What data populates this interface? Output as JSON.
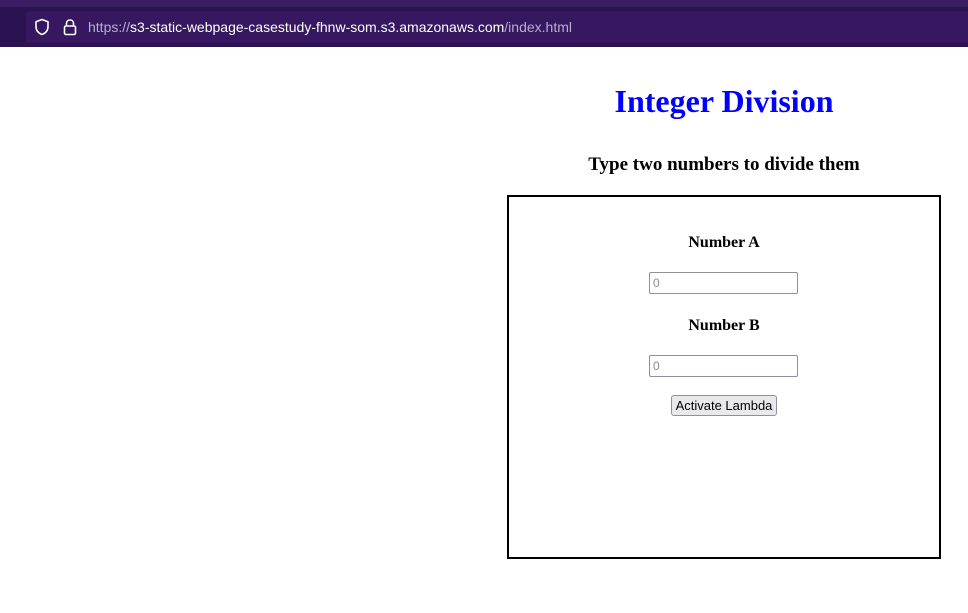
{
  "browser": {
    "url_scheme": "https://",
    "url_host": "s3-static-webpage-casestudy-fhnw-som.s3.amazonaws.com",
    "url_path": "/index.html",
    "icons": [
      "shield-icon",
      "lock-icon"
    ]
  },
  "page": {
    "title": "Integer Division",
    "subtitle": "Type two numbers to divide them",
    "title_color": "#0000ff"
  },
  "form": {
    "label_a": "Number A",
    "input_a_placeholder": "0",
    "label_b": "Number B",
    "input_b_placeholder": "0",
    "button_label": "Activate Lambda"
  }
}
